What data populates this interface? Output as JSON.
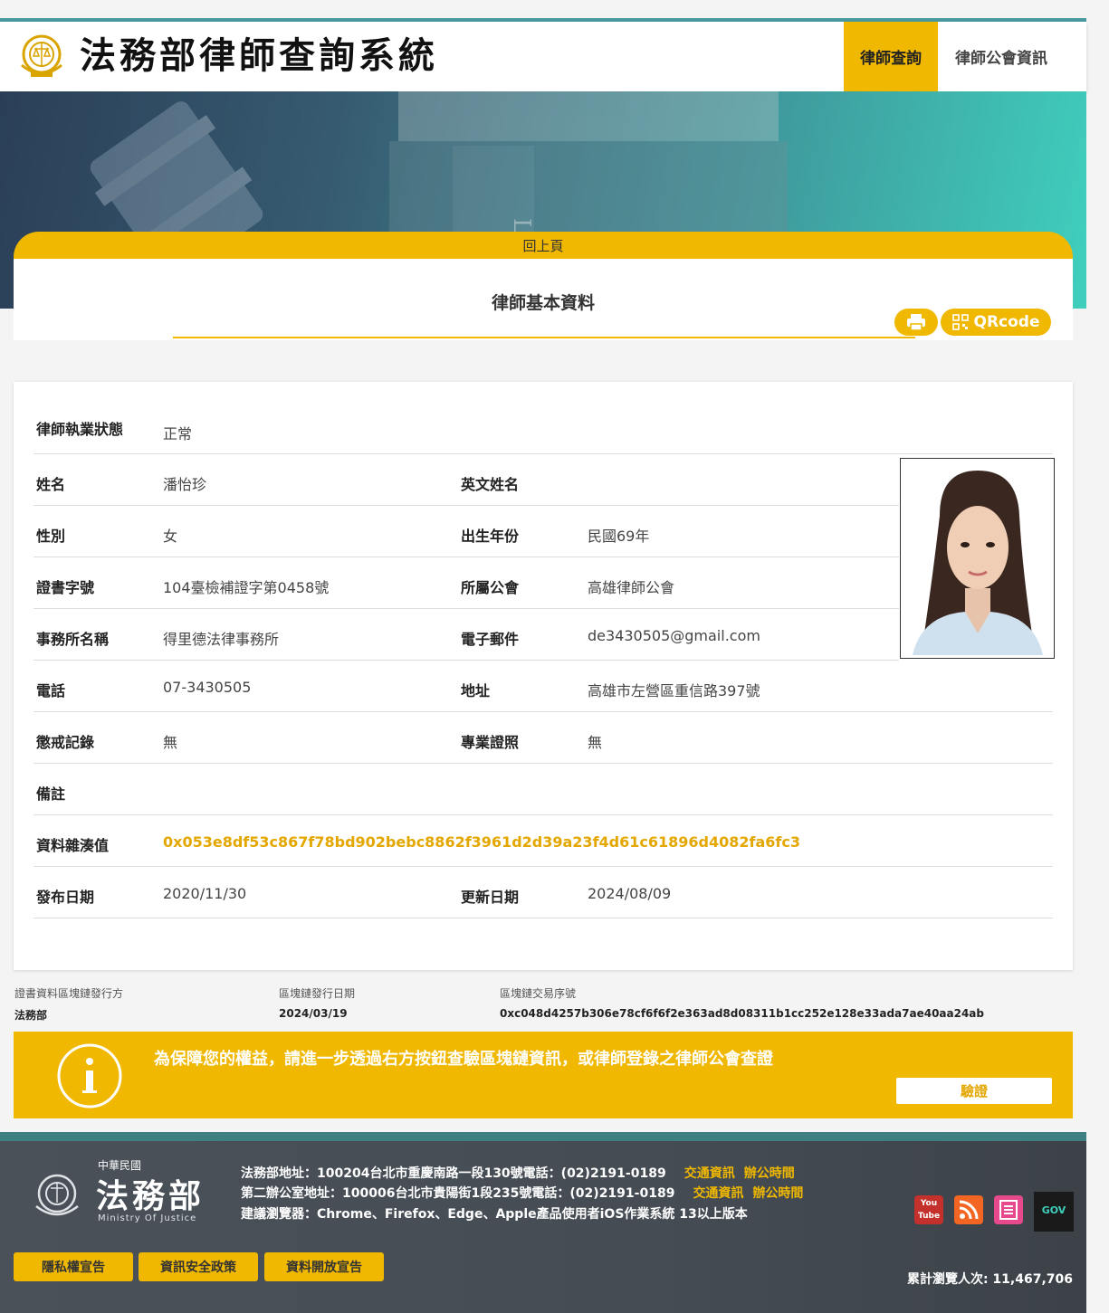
{
  "header": {
    "site_title": "法務部律師查詢系統",
    "nav": [
      {
        "label": "律師查詢",
        "active": true
      },
      {
        "label": "律師公會資訊",
        "active": false
      }
    ]
  },
  "card": {
    "back_label": "回上頁",
    "title": "律師基本資料",
    "qr_label": "QRcode"
  },
  "profile": {
    "status_label": "律師執業狀態",
    "status_value": "正常",
    "rows": [
      {
        "l1": "姓名",
        "v1": "潘怡珍",
        "l2": "英文姓名",
        "v2": ""
      },
      {
        "l1": "性別",
        "v1": "女",
        "l2": "出生年份",
        "v2": "民國69年"
      },
      {
        "l1": "證書字號",
        "v1": "104臺檢補證字第0458號",
        "l2": "所屬公會",
        "v2": "高雄律師公會"
      },
      {
        "l1": "事務所名稱",
        "v1": "得里德法律事務所",
        "l2": "電子郵件",
        "v2": "de3430505@gmail.com"
      },
      {
        "l1": "電話",
        "v1": "07-3430505",
        "l2": "地址",
        "v2": "高雄市左營區重信路397號"
      },
      {
        "l1": "懲戒記錄",
        "v1": "無",
        "l2": "專業證照",
        "v2": "無"
      }
    ],
    "remark_label": "備註",
    "remark_value": "",
    "hash_label": "資料雜湊值",
    "hash_value": "0x053e8df53c867f78bd902bebc8862f3961d2d39a23f4d61c61896d4082fa6fc3",
    "publish_label": "發布日期",
    "publish_value": "2020/11/30",
    "update_label": "更新日期",
    "update_value": "2024/08/09"
  },
  "chain": {
    "issuer_label": "證書資料區塊鏈發行方",
    "issuer_value": "法務部",
    "date_label": "區塊鏈發行日期",
    "date_value": "2024/03/19",
    "tx_label": "區塊鏈交易序號",
    "tx_value": "0xc048d4257b306e78cf6f6f2e363ad8d08311b1cc252e128e33ada7ae40aa24ab"
  },
  "notice": {
    "text": "為保障您的權益，請進一步透過右方按鈕查驗區塊鏈資訊，或律師登錄之律師公會查證",
    "verify_label": "驗證"
  },
  "footer": {
    "logo_top": "中華民國",
    "logo_main": "法務部",
    "logo_en": "Ministry Of Justice",
    "line1": "法務部地址：100204台北市重慶南路一段130號電話：(02)2191-0189",
    "line2": "第二辦公室地址：100006台北市貴陽街1段235號電話：(02)2191-0189",
    "line3": "建議瀏覽器：Chrome、Firefox、Edge、Apple產品使用者iOS作業系統 13以上版本",
    "traffic": "交通資訊",
    "hours": "辦公時間",
    "buttons": [
      "隱私權宣告",
      "資訊安全政策",
      "資料開放宣告"
    ],
    "counter": "累計瀏覽人次: 11,467,706",
    "youtube": "You Tube",
    "gov": "GOV"
  },
  "colors": {
    "accent": "#f0b800",
    "hash": "#e3a700",
    "teal": "#3fcfbd",
    "footer": "#4a5159"
  }
}
